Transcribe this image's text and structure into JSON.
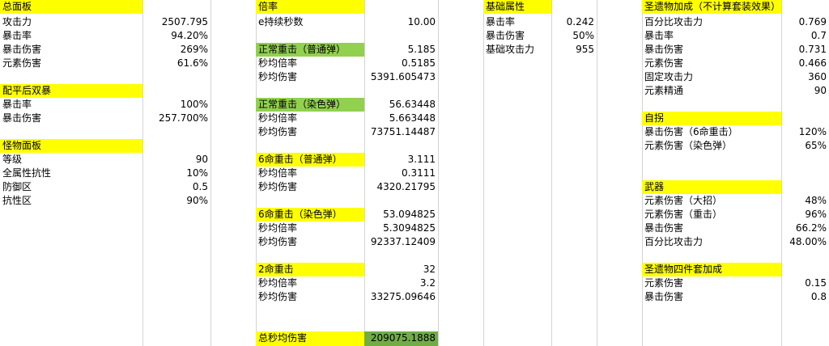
{
  "colors": {
    "header_yellow": "#ffff00",
    "header_green": "#92d050",
    "total_green": "#70ad47",
    "gridline": "#d4d4d4"
  },
  "panel_a": {
    "title": "总面板",
    "rows": [
      {
        "label": "攻击力",
        "value": "2507.795"
      },
      {
        "label": "暴击率",
        "value": "94.20%"
      },
      {
        "label": "暴击伤害",
        "value": "269%"
      },
      {
        "label": "元素伤害",
        "value": "61.6%"
      }
    ]
  },
  "panel_b": {
    "title": "配平后双暴",
    "rows": [
      {
        "label": "暴击率",
        "value": "100%"
      },
      {
        "label": "暴击伤害",
        "value": "257.700%"
      }
    ]
  },
  "panel_c": {
    "title": "怪物面板",
    "rows": [
      {
        "label": "等级",
        "value": "90"
      },
      {
        "label": "全属性抗性",
        "value": "10%"
      },
      {
        "label": "防御区",
        "value": "0.5"
      },
      {
        "label": "抗性区",
        "value": "90%"
      }
    ]
  },
  "mult": {
    "title": "倍率",
    "e_label": "e持续秒数",
    "e_value": "10.00",
    "blocks": [
      {
        "title": "正常重击（普通弹）",
        "value": "5.185",
        "rate_label": "秒均倍率",
        "rate": "0.5185",
        "dmg_label": "秒均伤害",
        "dmg": "5391.605473"
      },
      {
        "title": "正常重击（染色弹）",
        "value": "56.63448",
        "rate_label": "秒均倍率",
        "rate": "5.663448",
        "dmg_label": "秒均伤害",
        "dmg": "73751.14487"
      },
      {
        "title": "6命重击（普通弹）",
        "value": "3.111",
        "rate_label": "秒均倍率",
        "rate": "0.3111",
        "dmg_label": "秒均伤害",
        "dmg": "4320.21795"
      },
      {
        "title": "6命重击（染色弹）",
        "value": "53.094825",
        "rate_label": "秒均倍率",
        "rate": "5.3094825",
        "dmg_label": "秒均伤害",
        "dmg": "92337.12409"
      },
      {
        "title": "2命重击",
        "value": "32",
        "rate_label": "秒均倍率",
        "rate": "3.2",
        "dmg_label": "秒均伤害",
        "dmg": "33275.09646"
      }
    ],
    "total_label": "总秒均伤害",
    "total_value": "209075.1888"
  },
  "base": {
    "title": "基础属性",
    "rows": [
      {
        "label": "暴击率",
        "value": "0.242"
      },
      {
        "label": "暴击伤害",
        "value": "50%"
      },
      {
        "label": "基础攻击力",
        "value": "955"
      }
    ]
  },
  "artifact": {
    "title": "圣遗物加成（不计算套装效果）",
    "rows": [
      {
        "label": "百分比攻击力",
        "value": "0.769"
      },
      {
        "label": "暴击率",
        "value": "0.7"
      },
      {
        "label": "暴击伤害",
        "value": "0.731"
      },
      {
        "label": "元素伤害",
        "value": "0.466"
      },
      {
        "label": "固定攻击力",
        "value": "360"
      },
      {
        "label": "元素精通",
        "value": "90"
      }
    ]
  },
  "self": {
    "title": "自拐",
    "rows": [
      {
        "label": "暴击伤害（6命重击）",
        "value": "120%"
      },
      {
        "label": "元素伤害（染色弹）",
        "value": "65%"
      }
    ]
  },
  "weapon": {
    "title": "武器",
    "rows": [
      {
        "label": "元素伤害（大招）",
        "value": "48%"
      },
      {
        "label": "元素伤害（重击）",
        "value": "96%"
      },
      {
        "label": "暴击伤害",
        "value": "66.2%"
      },
      {
        "label": "百分比攻击力",
        "value": "48.00%"
      }
    ]
  },
  "set4": {
    "title": "圣遗物四件套加成",
    "rows": [
      {
        "label": "元素伤害",
        "value": "0.15"
      },
      {
        "label": "暴击伤害",
        "value": "0.8"
      }
    ]
  }
}
